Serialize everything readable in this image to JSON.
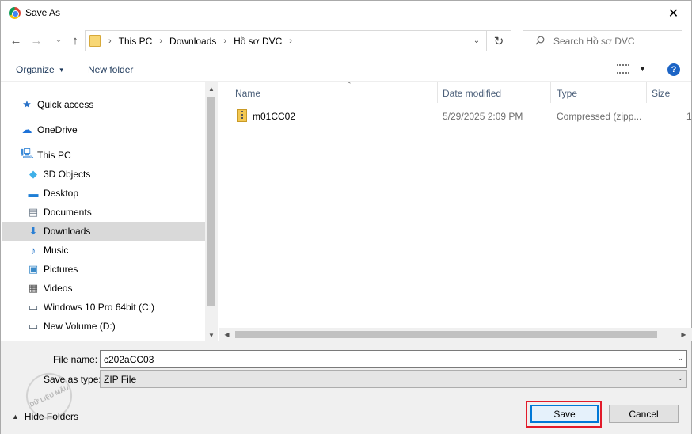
{
  "window": {
    "title": "Save As",
    "close_glyph": "✕"
  },
  "nav": {
    "back_glyph": "←",
    "forward_glyph": "→",
    "recent_glyph": "⌄",
    "up_glyph": "↑"
  },
  "address": {
    "breadcrumbs": [
      "This PC",
      "Downloads",
      "Hồ sơ DVC"
    ],
    "separator": "›",
    "dropdown_glyph": "⌄",
    "refresh_glyph": "↻"
  },
  "search": {
    "placeholder": "Search Hồ sơ DVC"
  },
  "toolbar": {
    "organize_label": "Organize",
    "organize_caret": "▼",
    "new_folder_label": "New folder",
    "view_caret": "▼",
    "help_label": "?"
  },
  "navpane": {
    "items": [
      {
        "label": "Quick access",
        "icon": "star-icon",
        "glyph": "★",
        "color": "#2a72c8"
      },
      {
        "label": "OneDrive",
        "icon": "cloud-icon",
        "glyph": "☁",
        "color": "#1d72d8"
      },
      {
        "label": "This PC",
        "icon": "computer-icon",
        "glyph": "🖳",
        "color": "#3b8ad8"
      },
      {
        "label": "3D Objects",
        "icon": "cube-icon",
        "glyph": "◆",
        "color": "#3fb0e8"
      },
      {
        "label": "Desktop",
        "icon": "desktop-icon",
        "glyph": "▬",
        "color": "#1f7fd6"
      },
      {
        "label": "Documents",
        "icon": "document-icon",
        "glyph": "▤",
        "color": "#6c7a89"
      },
      {
        "label": "Downloads",
        "icon": "download-icon",
        "glyph": "⬇",
        "color": "#2a7fd4"
      },
      {
        "label": "Music",
        "icon": "music-icon",
        "glyph": "♪",
        "color": "#1f72c8"
      },
      {
        "label": "Pictures",
        "icon": "pictures-icon",
        "glyph": "▣",
        "color": "#3a8ac8"
      },
      {
        "label": "Videos",
        "icon": "video-icon",
        "glyph": "▦",
        "color": "#555555"
      },
      {
        "label": "Windows 10 Pro 64bit (C:)",
        "icon": "drive-c-icon",
        "glyph": "▭",
        "color": "#4a5a6a"
      },
      {
        "label": "New Volume (D:)",
        "icon": "drive-d-icon",
        "glyph": "▭",
        "color": "#4a5a6a"
      }
    ],
    "selected": "Downloads",
    "scroll_up_glyph": "▲",
    "scroll_down_glyph": "▼"
  },
  "filelist": {
    "columns": [
      "Name",
      "Date modified",
      "Type",
      "Size"
    ],
    "sort_glyph": "⌃",
    "rows": [
      {
        "name": "m01CC02",
        "date": "5/29/2025 2:09 PM",
        "type": "Compressed (zipp...",
        "size": "1"
      }
    ],
    "scroll_left_glyph": "◀",
    "scroll_right_glyph": "▶"
  },
  "form": {
    "filename_label": "File name:",
    "filename_value": "c202aCC03",
    "savetype_label": "Save as type:",
    "savetype_value": "ZIP File",
    "caret_glyph": "⌄",
    "hide_folders_label": "Hide Folders",
    "hide_folders_caret": "▲",
    "watermark_text": "DỮ LIỆU MẪU",
    "save_label": "Save",
    "cancel_label": "Cancel"
  },
  "colors": {
    "accent": "#0078d7",
    "highlight_border": "#e21b2a",
    "selected_bg": "#d9d9d9",
    "link_text": "#1e395b"
  }
}
